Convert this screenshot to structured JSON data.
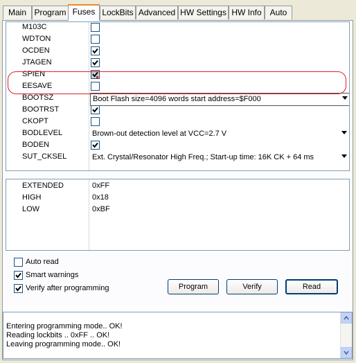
{
  "tabs": [
    "Main",
    "Program",
    "Fuses",
    "LockBits",
    "Advanced",
    "HW Settings",
    "HW Info",
    "Auto"
  ],
  "active_tab": "Fuses",
  "fuses": [
    {
      "name": "M103C",
      "type": "checkbox",
      "checked": false
    },
    {
      "name": "WDTON",
      "type": "checkbox",
      "checked": false
    },
    {
      "name": "OCDEN",
      "type": "checkbox",
      "checked": true
    },
    {
      "name": "JTAGEN",
      "type": "checkbox",
      "checked": true
    },
    {
      "name": "SPIEN",
      "type": "checkbox",
      "checked": true
    },
    {
      "name": "EESAVE",
      "type": "checkbox",
      "checked": false
    },
    {
      "name": "BOOTSZ",
      "type": "select",
      "value": "Boot Flash size=4096 words start address=$F000"
    },
    {
      "name": "BOOTRST",
      "type": "checkbox",
      "checked": true
    },
    {
      "name": "CKOPT",
      "type": "checkbox",
      "checked": false
    },
    {
      "name": "BODLEVEL",
      "type": "select",
      "value": "Brown-out detection level at VCC=2.7 V"
    },
    {
      "name": "BODEN",
      "type": "checkbox",
      "checked": true
    },
    {
      "name": "SUT_CKSEL",
      "type": "select",
      "value": "Ext. Crystal/Resonator High Freq.; Start-up time: 16K CK + 64 ms"
    }
  ],
  "fuse_bytes": [
    {
      "name": "EXTENDED",
      "value": "0xFF"
    },
    {
      "name": "HIGH",
      "value": "0x18"
    },
    {
      "name": "LOW",
      "value": "0xBF"
    }
  ],
  "options": {
    "auto_read": {
      "label": "Auto read",
      "checked": false
    },
    "smart_warnings": {
      "label": "Smart warnings",
      "checked": true
    },
    "verify_after": {
      "label": "Verify after programming",
      "checked": true
    }
  },
  "buttons": {
    "program": "Program",
    "verify": "Verify",
    "read": "Read"
  },
  "log": [
    "Entering programming mode.. OK!",
    "Reading lockbits .. 0xFF .. OK!",
    "Leaving programming mode.. OK!"
  ]
}
